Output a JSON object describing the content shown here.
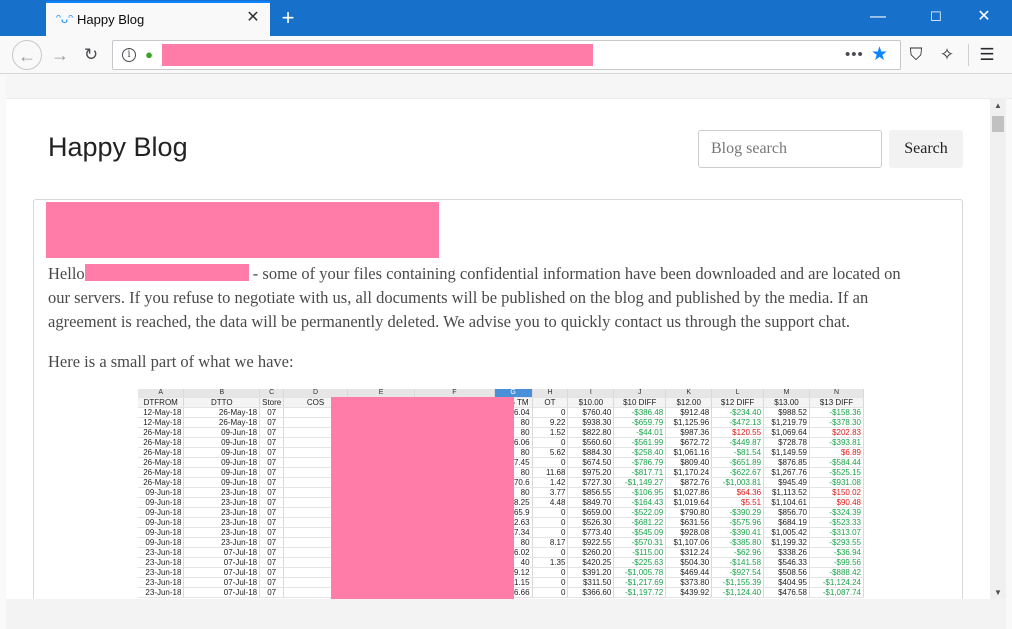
{
  "browser": {
    "tab_title": "Happy Blog",
    "tab_icon": "smiley-icon",
    "new_tab_label": "+",
    "window_controls": [
      "—",
      "☐",
      "✕"
    ]
  },
  "blog": {
    "title": "Happy Blog",
    "search_placeholder": "Blog search",
    "search_button": "Search"
  },
  "post": {
    "greeting": "Hello",
    "line1_rest": "- some of your files containing confidential information have been downloaded and are located on",
    "line2": "our servers. If you refuse to negotiate with us, all documents will be published on the blog and published by the media. If an",
    "line3": "agreement is reached, the data will be permanently deleted. We advise you to quickly contact us through the support chat.",
    "intro": "Here is a small part of what we have:"
  },
  "sheet": {
    "col_letters": [
      "A",
      "B",
      "C",
      "D",
      "E",
      "F",
      "G",
      "H",
      "I",
      "J",
      "K",
      "L",
      "M",
      "N"
    ],
    "headers": [
      "DTFROM",
      "DTTO",
      "Store",
      "COS",
      "",
      "",
      "REG TM",
      "OT",
      "$10.00",
      "$10 DIFF",
      "$12.00",
      "$12 DIFF",
      "$13.00",
      "$13 DIFF"
    ],
    "rows": [
      [
        "12-May-18",
        "26-May-18",
        "07",
        "76.04",
        "0",
        "$760.40",
        "-$386.48",
        "$912.48",
        "-$234.40",
        "$988.52",
        "-$158.36"
      ],
      [
        "12-May-18",
        "26-May-18",
        "07",
        "80",
        "9.22",
        "$938.30",
        "-$659.79",
        "$1,125.96",
        "-$472.13",
        "$1,219.79",
        "-$378.30"
      ],
      [
        "26-May-18",
        "09-Jun-18",
        "07",
        "80",
        "1.52",
        "$822.80",
        "-$44.01",
        "$987.36",
        "$120.55",
        "$1,069.64",
        "$202.83"
      ],
      [
        "26-May-18",
        "09-Jun-18",
        "07",
        "56.06",
        "0",
        "$560.60",
        "-$561.99",
        "$672.72",
        "-$449.87",
        "$728.78",
        "-$393.81"
      ],
      [
        "26-May-18",
        "09-Jun-18",
        "07",
        "80",
        "5.62",
        "$884.30",
        "-$258.40",
        "$1,061.16",
        "-$81.54",
        "$1,149.59",
        "$6.89"
      ],
      [
        "26-May-18",
        "09-Jun-18",
        "07",
        "67.45",
        "0",
        "$674.50",
        "-$786.79",
        "$809.40",
        "-$651.89",
        "$876.85",
        "-$584.44"
      ],
      [
        "26-May-18",
        "09-Jun-18",
        "07",
        "80",
        "11.68",
        "$975.20",
        "-$817.71",
        "$1,170.24",
        "-$622.67",
        "$1,267.76",
        "-$525.15"
      ],
      [
        "26-May-18",
        "09-Jun-18",
        "07",
        "70.6",
        "1.42",
        "$727.30",
        "-$1,149.27",
        "$872.76",
        "-$1,003.81",
        "$945.49",
        "-$931.08"
      ],
      [
        "09-Jun-18",
        "23-Jun-18",
        "07",
        "80",
        "3.77",
        "$856.55",
        "-$106.95",
        "$1,027.86",
        "$64.36",
        "$1,113.52",
        "$150.02"
      ],
      [
        "09-Jun-18",
        "23-Jun-18",
        "07",
        "78.25",
        "4.48",
        "$849.70",
        "-$164.43",
        "$1,019.64",
        "$5.51",
        "$1,104.61",
        "$90.48"
      ],
      [
        "09-Jun-18",
        "23-Jun-18",
        "07",
        "65.9",
        "0",
        "$659.00",
        "-$522.09",
        "$790.80",
        "-$390.29",
        "$856.70",
        "-$324.39"
      ],
      [
        "09-Jun-18",
        "23-Jun-18",
        "07",
        "52.63",
        "0",
        "$526.30",
        "-$681.22",
        "$631.56",
        "-$575.96",
        "$684.19",
        "-$523.33"
      ],
      [
        "09-Jun-18",
        "23-Jun-18",
        "07",
        "77.34",
        "0",
        "$773.40",
        "-$545.09",
        "$928.08",
        "-$390.41",
        "$1,005.42",
        "-$313.07"
      ],
      [
        "09-Jun-18",
        "23-Jun-18",
        "07",
        "80",
        "8.17",
        "$922.55",
        "-$570.31",
        "$1,107.06",
        "-$385.80",
        "$1,199.32",
        "-$293.55"
      ],
      [
        "23-Jun-18",
        "07-Jul-18",
        "07",
        "26.02",
        "0",
        "$260.20",
        "-$115.00",
        "$312.24",
        "-$62.96",
        "$338.26",
        "-$36.94"
      ],
      [
        "23-Jun-18",
        "07-Jul-18",
        "07",
        "40",
        "1.35",
        "$420.25",
        "-$225.63",
        "$504.30",
        "-$141.58",
        "$546.33",
        "-$99.56"
      ],
      [
        "23-Jun-18",
        "07-Jul-18",
        "07",
        "39.12",
        "0",
        "$391.20",
        "-$1,005.78",
        "$469.44",
        "-$927.54",
        "$508.56",
        "-$888.42"
      ],
      [
        "23-Jun-18",
        "07-Jul-18",
        "07",
        "31.15",
        "0",
        "$311.50",
        "-$1,217.69",
        "$373.80",
        "-$1,155.39",
        "$404.95",
        "-$1,124.24"
      ],
      [
        "23-Jun-18",
        "07-Jul-18",
        "07",
        "36.66",
        "0",
        "$366.60",
        "-$1,197.72",
        "$439.92",
        "-$1,124.40",
        "$476.58",
        "-$1,087.74"
      ]
    ],
    "negative_color": "#1aa34a",
    "positive_color": "#e01818"
  },
  "colors": {
    "titlebar": "#1770c9",
    "accent": "#0a84ff",
    "redaction": "#ff7ca9"
  }
}
